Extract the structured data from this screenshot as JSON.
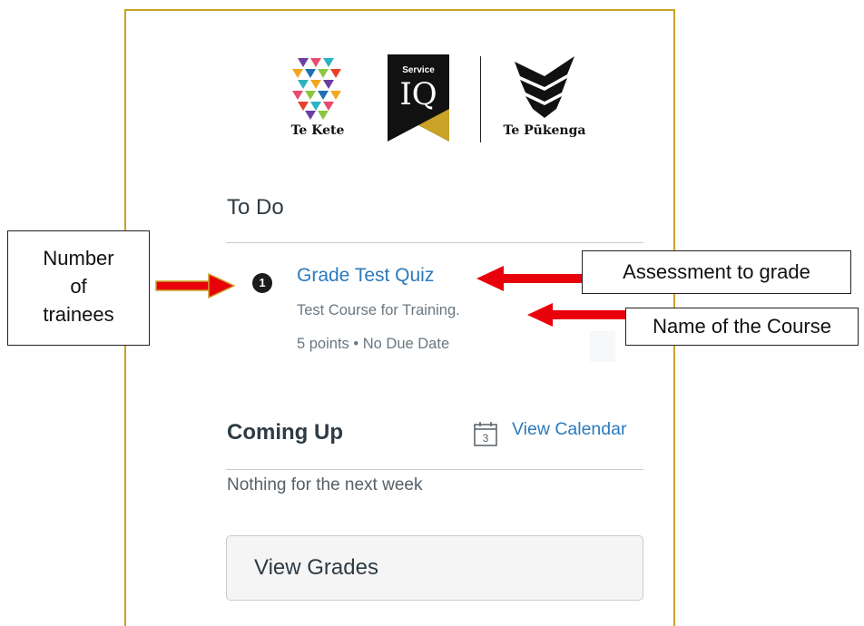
{
  "logos": {
    "te_kete": "Te Kete",
    "service_iq_top": "Service",
    "service_iq_main": "IQ",
    "te_pukenga": "Te Pūkenga"
  },
  "todo": {
    "heading": "To Do",
    "item": {
      "count": "1",
      "title": "Grade Test Quiz",
      "course": "Test Course for Training.",
      "meta": "5 points • No Due Date"
    }
  },
  "coming_up": {
    "heading": "Coming Up",
    "calendar_day": "3",
    "calendar_link": "View Calendar",
    "empty_text": "Nothing for the next week"
  },
  "grades_button": "View Grades",
  "annotations": {
    "trainees_lines": [
      "Number",
      "of",
      "trainees"
    ],
    "assessment": "Assessment to grade",
    "course_name": "Name of the Course"
  },
  "colors": {
    "link": "#2b7abc",
    "frame": "#c9a227",
    "arrow": "#e8000b"
  }
}
